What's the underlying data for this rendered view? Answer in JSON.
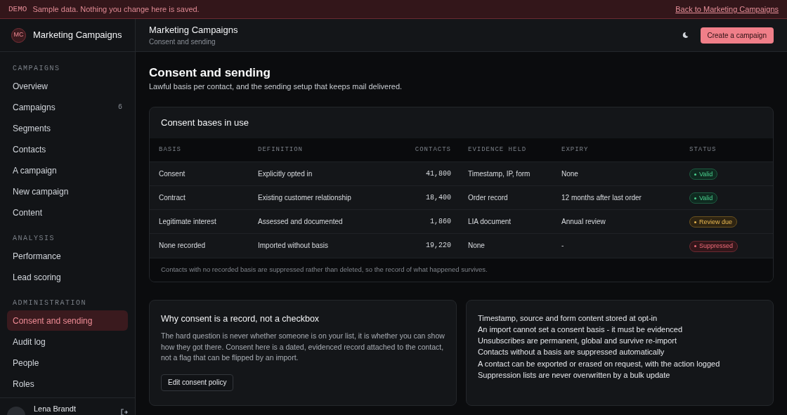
{
  "demo_banner": {
    "tag": "DEMO",
    "message": "Sample data. Nothing you change here is saved.",
    "link": "Back to Marketing Campaigns"
  },
  "sidebar": {
    "logo": "MC",
    "app_name": "Marketing Campaigns",
    "sections": [
      {
        "title": "CAMPAIGNS",
        "items": [
          {
            "label": "Overview",
            "selected": false
          },
          {
            "label": "Campaigns",
            "count": "6",
            "selected": false
          },
          {
            "label": "Segments",
            "selected": false
          },
          {
            "label": "Contacts",
            "selected": false
          },
          {
            "label": "A campaign",
            "selected": false
          },
          {
            "label": "New campaign",
            "selected": false
          },
          {
            "label": "Content",
            "selected": false
          }
        ]
      },
      {
        "title": "ANALYSIS",
        "items": [
          {
            "label": "Performance",
            "selected": false
          },
          {
            "label": "Lead scoring",
            "selected": false
          }
        ]
      },
      {
        "title": "ADMINISTRATION",
        "items": [
          {
            "label": "Consent and sending",
            "selected": true
          },
          {
            "label": "Audit log",
            "selected": false
          },
          {
            "label": "People",
            "selected": false
          },
          {
            "label": "Roles",
            "selected": false
          }
        ]
      }
    ],
    "user": {
      "name": "Lena Brandt"
    }
  },
  "header": {
    "title": "Marketing Campaigns",
    "breadcrumb": "Consent and sending",
    "primary_button": "Create a campaign"
  },
  "page": {
    "title": "Consent and sending",
    "subtitle": "Lawful basis per contact, and the sending setup that keeps mail delivered."
  },
  "table_card": {
    "title": "Consent bases in use",
    "columns": [
      "BASIS",
      "DEFINITION",
      "CONTACTS",
      "EVIDENCE HELD",
      "EXPIRY",
      "STATUS"
    ],
    "rows": [
      {
        "basis": "Consent",
        "definition": "Explicitly opted in",
        "contacts": "41,800",
        "evidence": "Timestamp, IP, form",
        "expiry": "None",
        "status": "Valid",
        "kind": "valid"
      },
      {
        "basis": "Contract",
        "definition": "Existing customer relationship",
        "contacts": "18,400",
        "evidence": "Order record",
        "expiry": "12 months after last order",
        "status": "Valid",
        "kind": "valid"
      },
      {
        "basis": "Legitimate interest",
        "definition": "Assessed and documented",
        "contacts": "1,860",
        "evidence": "LIA document",
        "expiry": "Annual review",
        "status": "Review due",
        "kind": "warning"
      },
      {
        "basis": "None recorded",
        "definition": "Imported without basis",
        "contacts": "19,220",
        "evidence": "None",
        "expiry": "-",
        "status": "Suppressed",
        "kind": "danger"
      }
    ],
    "footnote": "Contacts with no recorded basis are suppressed rather than deleted, so the record of what happened survives."
  },
  "info_card": {
    "title": "Why consent is a record, not a checkbox",
    "body": "The hard question is never whether someone is on your list, it is whether you can show how they got there. Consent here is a dated, evidenced record attached to the contact, not a flag that can be flipped by an import.",
    "button": "Edit consent policy"
  },
  "rules_card": {
    "lines": [
      "Timestamp, source and form content stored at opt-in",
      "An import cannot set a consent basis - it must be evidenced",
      "Unsubscribes are permanent, global and survive re-import",
      "Contacts without a basis are suppressed automatically",
      "A contact can be exported or erased on request, with the action logged",
      "Suppression lists are never overwritten by a bulk update"
    ]
  }
}
